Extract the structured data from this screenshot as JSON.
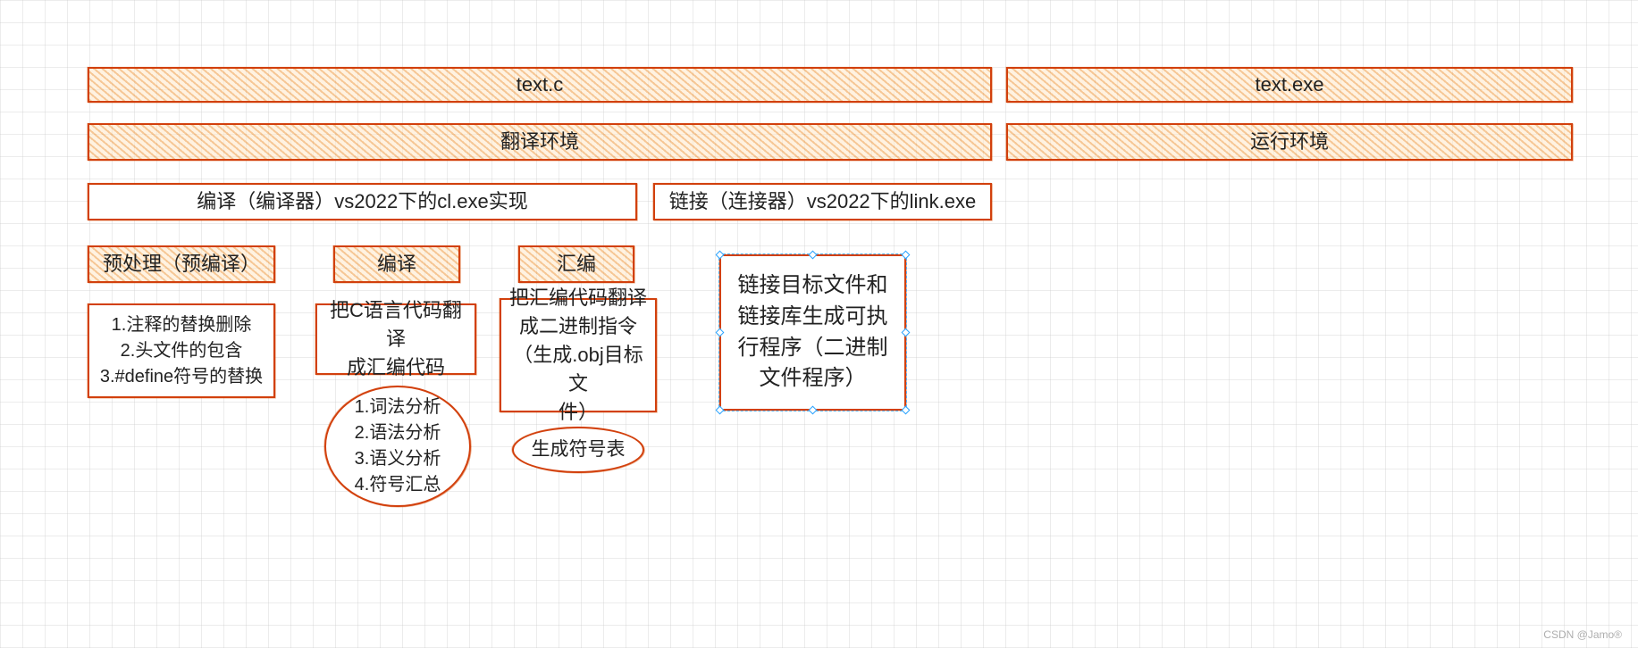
{
  "row1": {
    "source_file": "text.c",
    "exe_file": "text.exe"
  },
  "row2": {
    "translate_env": "翻译环境",
    "runtime_env": "运行环境"
  },
  "row3": {
    "compile_tool": "编译（编译器）vs2022下的cl.exe实现",
    "link_tool": "链接（连接器）vs2022下的link.exe"
  },
  "stages": {
    "preprocess_title": "预处理（预编译）",
    "compile_title": "编译",
    "assemble_title": "汇编"
  },
  "preprocess_detail_lines": [
    "1.注释的替换删除",
    "2.头文件的包含",
    "3.#define符号的替换"
  ],
  "compile_detail_lines": [
    "把C语言代码翻译",
    "成汇编代码"
  ],
  "compile_sub_lines": [
    "1.词法分析",
    "2.语法分析",
    "3.语义分析",
    "4.符号汇总"
  ],
  "assemble_detail_lines": [
    "把汇编代码翻译",
    "成二进制指令",
    "（生成.obj目标文",
    "件）"
  ],
  "assemble_sub": "生成符号表",
  "link_detail_lines": [
    "链接目标文件和",
    "链接库生成可执",
    "行程序（二进制",
    "文件程序）"
  ],
  "watermark": "CSDN @Jamo®"
}
